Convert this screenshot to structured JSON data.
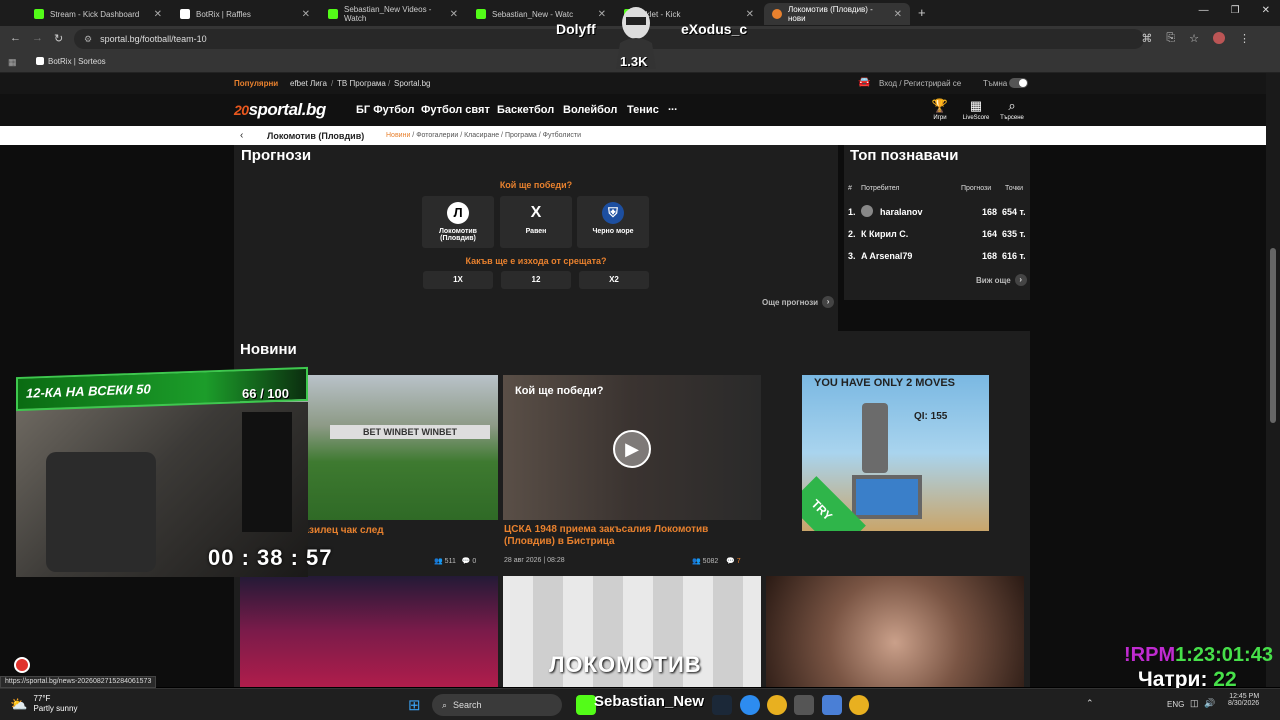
{
  "browser": {
    "tabs": [
      {
        "label": "Stream - Kick Dashboard",
        "color": "#53fc18"
      },
      {
        "label": "BotRix | Raffles",
        "color": "#ffffff"
      },
      {
        "label": "Sebastian_New Videos - Watch",
        "color": "#53fc18"
      },
      {
        "label": "Sebastian_New - Watc",
        "color": "#53fc18"
      },
      {
        "label": "icklet - Kick",
        "color": "#53fc18"
      },
      {
        "label": "Локомотив (Пловдив) - нови",
        "color": "#e8812e"
      }
    ],
    "url": "sportal.bg/football/team-10",
    "bookmark": "BotRix | Sorteos",
    "new_tab": "+"
  },
  "stream_overlay": {
    "names": [
      "Dolyff",
      "eXodus_c"
    ],
    "badge": "1.3K",
    "camera_banner": "12-КА НА ВСЕКИ 50",
    "camera_counter": "66 / 100",
    "timer": "00 : 38 : 57",
    "rpm_label": "!RPM",
    "rpm_value": "1:23:01:43",
    "chat_label": "Чатри:",
    "chat_value": "22"
  },
  "site": {
    "popular_label": "Популярни",
    "popular_links": [
      "efbet Лига",
      "ТВ Програма",
      "Sportal.bg"
    ],
    "login": "Вход / Регистрирай се",
    "dark_label": "Тъмна",
    "logo_num": "20",
    "logo_text": "sportal.bg",
    "nav": [
      "БГ Футбол",
      "Футбол свят",
      "Баскетбол",
      "Волейбол",
      "Тенис"
    ],
    "nav_more": "...",
    "nav_icons": [
      "Игри",
      "LiveScore",
      "Търсене"
    ],
    "team": "Локомотив (Пловдив)",
    "subnav_active": "Новини",
    "subnav_rest": " / Фотогалерии / Класиране / Програма / Футболисти"
  },
  "predictions": {
    "title": "Прогнози",
    "q1": "Кой ще победи?",
    "options": [
      {
        "label": "Локомотив (Пловдив)",
        "icon": "Л"
      },
      {
        "label": "Равен",
        "icon": "X"
      },
      {
        "label": "Черно море",
        "icon": "⛨"
      }
    ],
    "q2": "Какъв ще е изхода от срещата?",
    "outcomes": [
      "1X",
      "12",
      "X2"
    ],
    "more": "Още прогнози"
  },
  "leaderboard": {
    "title": "Топ познавачи",
    "headers": [
      "#",
      "Потребител",
      "Прогнози",
      "Точки"
    ],
    "rows": [
      {
        "rank": "1.",
        "user": "haralanov",
        "preds": "168",
        "points": "654 т."
      },
      {
        "rank": "2.",
        "user": "К Кирил С.",
        "preds": "164",
        "points": "635 т."
      },
      {
        "rank": "3.",
        "user": "A Arsenal79",
        "preds": "168",
        "points": "616 т."
      }
    ],
    "more": "Виж още"
  },
  "news": {
    "title": "Новини",
    "items": [
      {
        "title": "в) уреждa бразилец чак след",
        "comments": "511",
        "likes": "0",
        "date": ""
      },
      {
        "title": "ЦСКА 1948 приема закъсалия Локомотив (Пловдив) в Бистрица",
        "date": "28 авг 2026 | 08:28",
        "views": "5082",
        "comments": "7"
      }
    ],
    "thumb2_caption": "Кой ще победи?",
    "thumb3_caption": "ЛОКОМОТИВ",
    "ad_text": "YOU HAVE ONLY 2 MOVES",
    "ad_iq": "QI: 155",
    "ad_try": "TRY"
  },
  "status_url": "https://sportal.bg/news-2026082715284061573",
  "taskbar": {
    "weather_temp": "77°F",
    "weather_desc": "Partly sunny",
    "search": "Search",
    "stream_name": "Sebastian_New",
    "lang": "ENG",
    "time": "12:45 PM",
    "date": "8/30/2026"
  }
}
